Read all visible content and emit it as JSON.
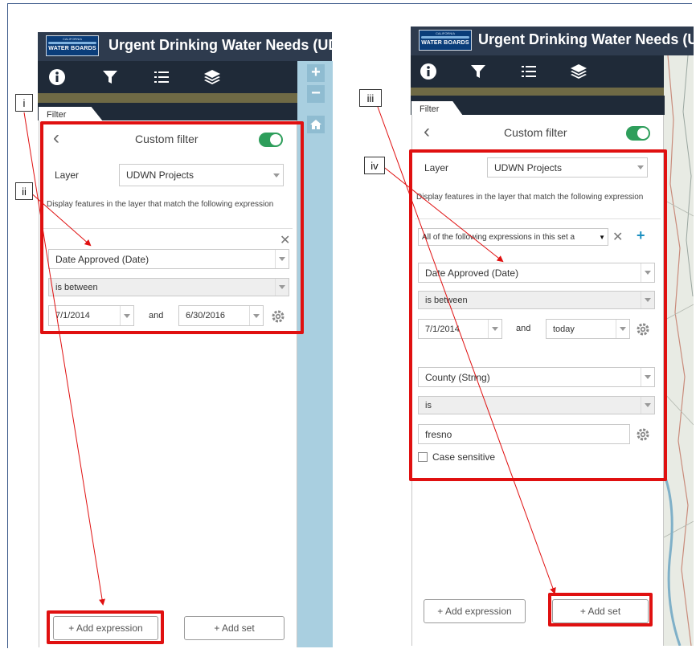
{
  "app": {
    "title": "Urgent Drinking Water Needs (UDW",
    "title_right": "Urgent Drinking Water Needs (UD",
    "logo_text": "WATER BOARDS",
    "logo_top": "CALIFORNIA",
    "tabs": [
      "info-icon",
      "filter-icon",
      "list-icon",
      "layers-icon"
    ]
  },
  "filter_tab": "Filter",
  "left": {
    "panel_title": "Custom filter",
    "layer_label": "Layer",
    "layer_value": "UDWN Projects",
    "description": "Display features in the layer that match the following expression",
    "field": "Date Approved (Date)",
    "operator": "is between",
    "from": "7/1/2014",
    "and": "and",
    "to": "6/30/2016",
    "add_expression": "+ Add expression",
    "add_set": "+ Add set"
  },
  "right": {
    "panel_title": "Custom filter",
    "layer_label": "Layer",
    "layer_value": "UDWN Projects",
    "description": "Display features in the layer that match the following expression",
    "set_mode": "All of the following expressions in this set a",
    "expr1_field": "Date Approved (Date)",
    "expr1_operator": "is between",
    "expr1_from": "7/1/2014",
    "expr1_and": "and",
    "expr1_to": "today",
    "expr2_field": "County (String)",
    "expr2_operator": "is",
    "expr2_value": "fresno",
    "case_sensitive": "Case sensitive",
    "add_expression": "+ Add expression",
    "add_set": "+ Add set"
  },
  "callouts": [
    "i",
    "ii",
    "iii",
    "iv"
  ],
  "colors": {
    "header": "#2e3b4e",
    "accent_red": "#e01010",
    "toggle_on": "#2e9e5b"
  }
}
